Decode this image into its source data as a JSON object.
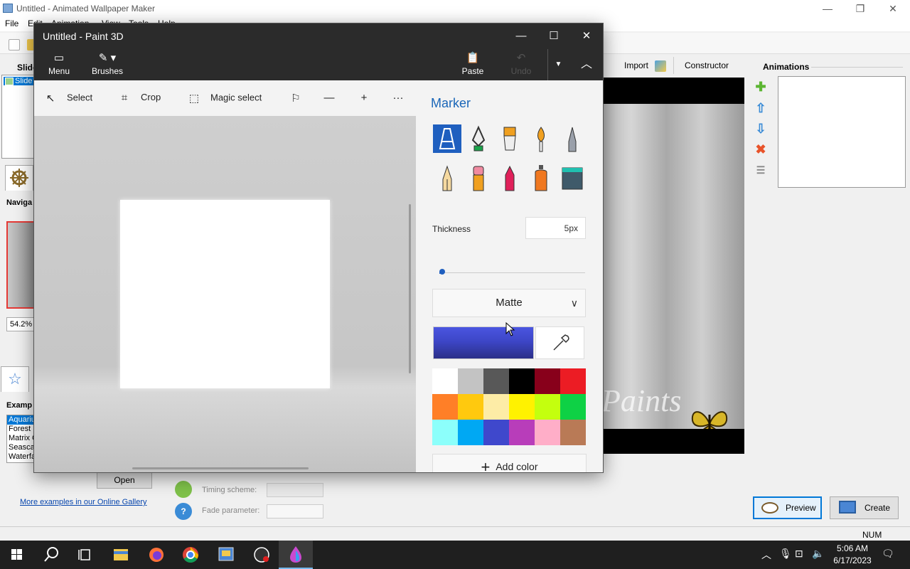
{
  "background_app": {
    "title": "Untitled - Animated Wallpaper Maker",
    "menu": [
      "File",
      "Edit",
      "Animation",
      "View",
      "Tools",
      "Help"
    ],
    "slides_label": "Slide",
    "slides_item": "Slide",
    "navigator_label": "Naviga",
    "zoom_value": "54.2%",
    "examples_label": "Examp",
    "examples": [
      "Aquariu",
      "Forest I",
      "Matrix C",
      "Seascap",
      "Waterfa"
    ],
    "open_button": "Open",
    "gallery_link": "More examples in our Online Gallery",
    "timing_scheme_label": "Timing scheme:",
    "fade_parameter_label": "Fade parameter:",
    "import_button": "Import",
    "constructor_button": "Constructor",
    "animations_label": "Animations",
    "preview_text": "Paints",
    "preview_button": "Preview",
    "create_button": "Create",
    "status_num": "NUM"
  },
  "paint3d": {
    "title": "Untitled - Paint 3D",
    "ribbon": {
      "menu_label": "Menu",
      "brushes_label": "Brushes",
      "paste_label": "Paste",
      "undo_label": "Undo"
    },
    "tools": {
      "select_label": "Select",
      "crop_label": "Crop",
      "magic_select_label": "Magic select"
    },
    "panel": {
      "title": "Marker",
      "brushes": [
        "marker",
        "calligraphy-pen",
        "oil-brush",
        "watercolor",
        "pixel-pen",
        "pencil",
        "eraser",
        "crayon",
        "spray-can",
        "fill"
      ],
      "selected_brush": "marker",
      "thickness_label": "Thickness",
      "thickness_value": "5px",
      "thickness_level_percent": 1,
      "finish_value": "Matte",
      "current_color": "#3d46c7",
      "palette": [
        "#ffffff",
        "#c3c3c3",
        "#585858",
        "#000000",
        "#88001b",
        "#ec1c24",
        "#ff7f27",
        "#ffc90e",
        "#fdeca6",
        "#fff200",
        "#c4ff0e",
        "#0ed145",
        "#8cfffb",
        "#00a8f3",
        "#3f48cc",
        "#b83dba",
        "#ffaec8",
        "#b97a56"
      ],
      "add_color_label": "Add color"
    }
  },
  "taskbar": {
    "apps": [
      "start",
      "search",
      "task-view",
      "file-explorer",
      "firefox",
      "chrome",
      "wallpaper-maker",
      "obs",
      "paint3d"
    ],
    "time": "5:06 AM",
    "date": "6/17/2023"
  }
}
